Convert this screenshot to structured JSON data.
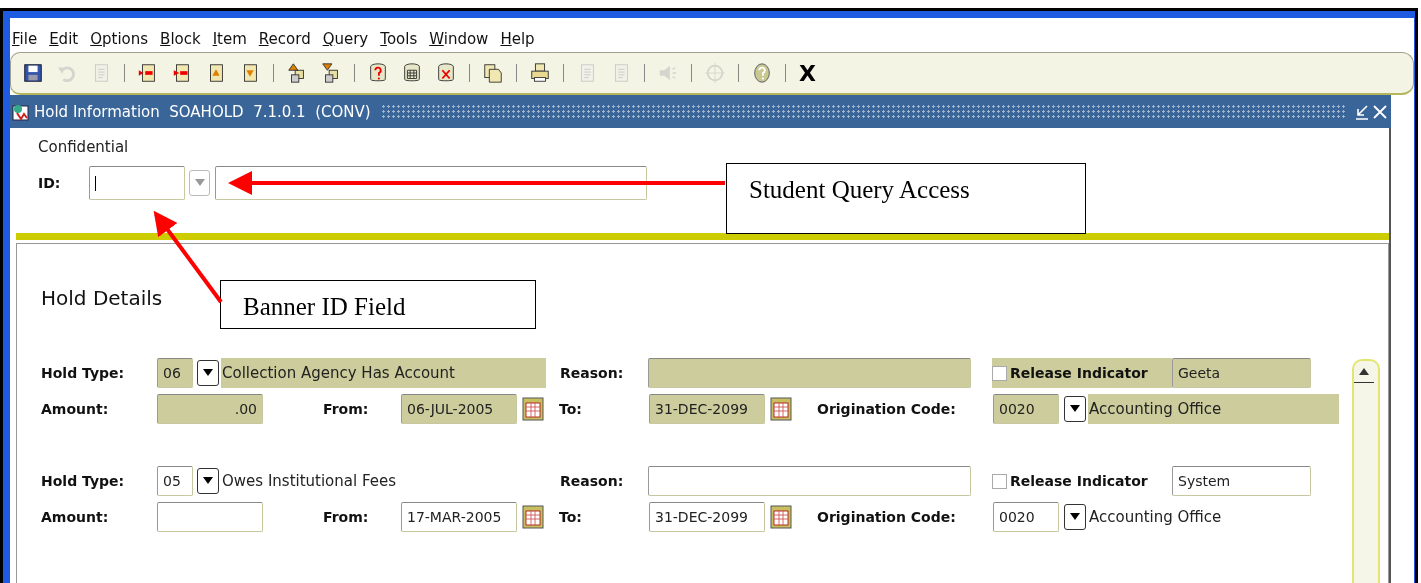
{
  "menu": [
    "File",
    "Edit",
    "Options",
    "Block",
    "Item",
    "Record",
    "Query",
    "Tools",
    "Window",
    "Help"
  ],
  "toolbar": {
    "items": [
      {
        "kind": "save",
        "disabled": false
      },
      {
        "kind": "undo",
        "disabled": true
      },
      {
        "kind": "document",
        "disabled": true
      },
      {
        "kind": "separator"
      },
      {
        "kind": "insert",
        "disabled": false
      },
      {
        "kind": "remove",
        "disabled": false
      },
      {
        "kind": "doc-up",
        "disabled": false
      },
      {
        "kind": "doc-down",
        "disabled": false
      },
      {
        "kind": "separator"
      },
      {
        "kind": "stack-up",
        "disabled": false
      },
      {
        "kind": "stack-down",
        "disabled": false
      },
      {
        "kind": "separator"
      },
      {
        "kind": "db-question",
        "disabled": false
      },
      {
        "kind": "db-grid",
        "disabled": false
      },
      {
        "kind": "db-x",
        "disabled": false
      },
      {
        "kind": "separator"
      },
      {
        "kind": "copy",
        "disabled": false
      },
      {
        "kind": "separator"
      },
      {
        "kind": "printer",
        "disabled": false
      },
      {
        "kind": "separator"
      },
      {
        "kind": "doc-lines",
        "disabled": true
      },
      {
        "kind": "doc-lines",
        "disabled": true
      },
      {
        "kind": "separator"
      },
      {
        "kind": "speaker",
        "disabled": true
      },
      {
        "kind": "separator"
      },
      {
        "kind": "crosshair",
        "disabled": true
      },
      {
        "kind": "separator"
      },
      {
        "kind": "help",
        "disabled": false
      },
      {
        "kind": "separator"
      }
    ],
    "exit_label": "X"
  },
  "form_window": {
    "title": "Hold Information  SOAHOLD  7.1.0.1  (CONV)"
  },
  "key_block": {
    "confidential_label": "Confidential",
    "id_label": "ID:"
  },
  "section_title": "Hold Details",
  "records": [
    {
      "selected": true,
      "labels": {
        "hold_type": "Hold Type:",
        "reason": "Reason:",
        "release_indicator": "Release Indicator",
        "amount": "Amount:",
        "from": "From:",
        "to": "To:",
        "origination_code": "Origination Code:"
      },
      "hold_type_code": "06",
      "hold_type_desc": "Collection Agency Has Account",
      "release_checked": false,
      "user": "Geeta",
      "amount": ".00",
      "from": "06-JUL-2005",
      "to": "31-DEC-2099",
      "origination_code": "0020",
      "origination_desc": "Accounting Office"
    },
    {
      "selected": false,
      "labels": {
        "hold_type": "Hold Type:",
        "reason": "Reason:",
        "release_indicator": "Release Indicator",
        "amount": "Amount:",
        "from": "From:",
        "to": "To:",
        "origination_code": "Origination Code:"
      },
      "hold_type_code": "05",
      "hold_type_desc": "Owes Institutional Fees",
      "release_checked": false,
      "user": "System",
      "from": "17-MAR-2005",
      "to": "31-DEC-2099",
      "origination_code": "0020",
      "origination_desc": "Accounting Office"
    }
  ],
  "callouts": [
    {
      "text": "Student Query Access"
    },
    {
      "text": "Banner ID Field"
    }
  ]
}
